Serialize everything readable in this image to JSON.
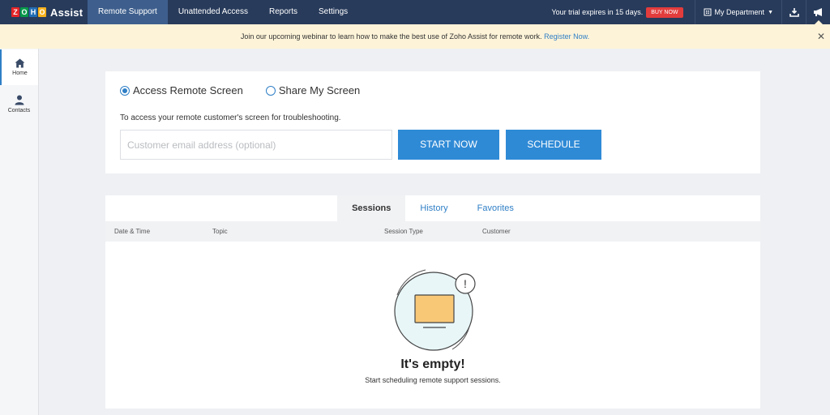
{
  "app": {
    "logo_letters": [
      "Z",
      "O",
      "H",
      "O"
    ],
    "logo_text": "Assist"
  },
  "nav": {
    "items": [
      {
        "label": "Remote Support",
        "active": true
      },
      {
        "label": "Unattended Access",
        "active": false
      },
      {
        "label": "Reports",
        "active": false
      },
      {
        "label": "Settings",
        "active": false
      }
    ],
    "trial_text": "Your trial expires in 15 days.",
    "buy_now": "BUY NOW",
    "department": "My Department",
    "icons": [
      "building-icon",
      "download-icon",
      "megaphone-icon"
    ]
  },
  "banner": {
    "text": "Join our upcoming webinar to learn how to make the best use of Zoho Assist for remote work.",
    "link": "Register Now.",
    "close": "✕",
    "background": "#fdf3d8"
  },
  "sidebar": {
    "items": [
      {
        "label": "Home",
        "icon": "home-icon",
        "active": true
      },
      {
        "label": "Contacts",
        "icon": "contact-icon",
        "active": false
      }
    ]
  },
  "access": {
    "options": [
      {
        "label": "Access Remote Screen",
        "checked": true
      },
      {
        "label": "Share My Screen",
        "checked": false
      }
    ],
    "description": "To access your remote customer's screen for troubleshooting.",
    "email_placeholder": "Customer email address (optional)",
    "email_value": "",
    "start_button": "START NOW",
    "schedule_button": "SCHEDULE"
  },
  "sessions": {
    "tabs": [
      {
        "label": "Sessions",
        "active": true
      },
      {
        "label": "History",
        "active": false
      },
      {
        "label": "Favorites",
        "active": false
      }
    ],
    "columns": [
      "Date & Time",
      "Topic",
      "Session Type",
      "Customer"
    ],
    "empty_title": "It's empty!",
    "empty_subtitle": "Start scheduling remote support sessions.",
    "empty_badge": "!"
  },
  "colors": {
    "nav_bg": "#283b5b",
    "nav_active": "#3e5f8d",
    "accent": "#2f8ad6",
    "buy_now": "#e33c3c"
  }
}
